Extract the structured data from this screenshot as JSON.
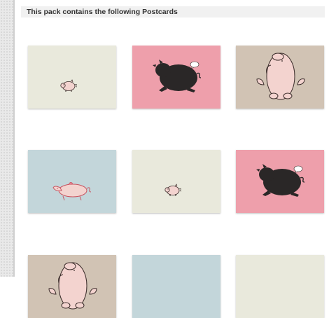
{
  "header": {
    "title": "This pack contains the following Postcards"
  },
  "colors": {
    "cream": "#e9e9dc",
    "pink": "#ee9fab",
    "tan": "#d1c3b4",
    "blue": "#c3d6da",
    "pig_pink": "#f3d3cf",
    "pig_black": "#2a2727",
    "outline": "#3a2c2a"
  },
  "postcards": [
    {
      "background": "cream",
      "illustration": "small-pink-pig"
    },
    {
      "background": "pink",
      "illustration": "black-pig-running-with-speech-bubble"
    },
    {
      "background": "tan",
      "illustration": "pink-pig-standing-upright"
    },
    {
      "background": "blue",
      "illustration": "pink-pig-lying-down"
    },
    {
      "background": "cream",
      "illustration": "small-pink-pig"
    },
    {
      "background": "pink",
      "illustration": "black-pig-running-with-speech-bubble"
    },
    {
      "background": "tan",
      "illustration": "pink-pig-standing-upright"
    },
    {
      "background": "blue",
      "illustration": "empty"
    },
    {
      "background": "cream",
      "illustration": "empty"
    }
  ]
}
